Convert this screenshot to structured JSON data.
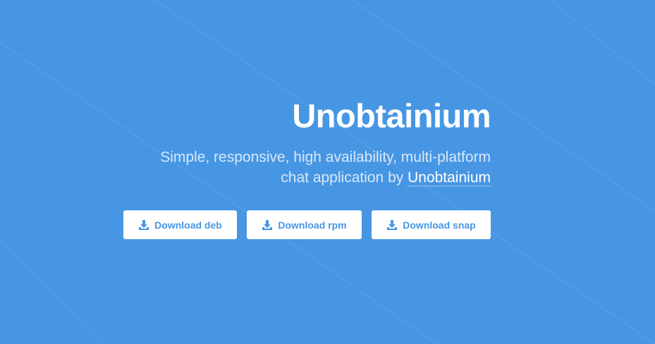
{
  "hero": {
    "title": "Unobtainium",
    "subtitle_line1": "Simple, responsive, high availability, multi-platform",
    "subtitle_line2_prefix": "chat application by",
    "author_link": "Unobtainium"
  },
  "downloads": {
    "deb_label": "Download deb",
    "rpm_label": "Download rpm",
    "snap_label": "Download snap"
  },
  "icons": {
    "download": "download-icon"
  },
  "colors": {
    "background": "#4796e3",
    "accent": "#4796e3",
    "button_bg": "#ffffff",
    "title": "#ffffff",
    "subtitle": "#d7e8fa"
  }
}
